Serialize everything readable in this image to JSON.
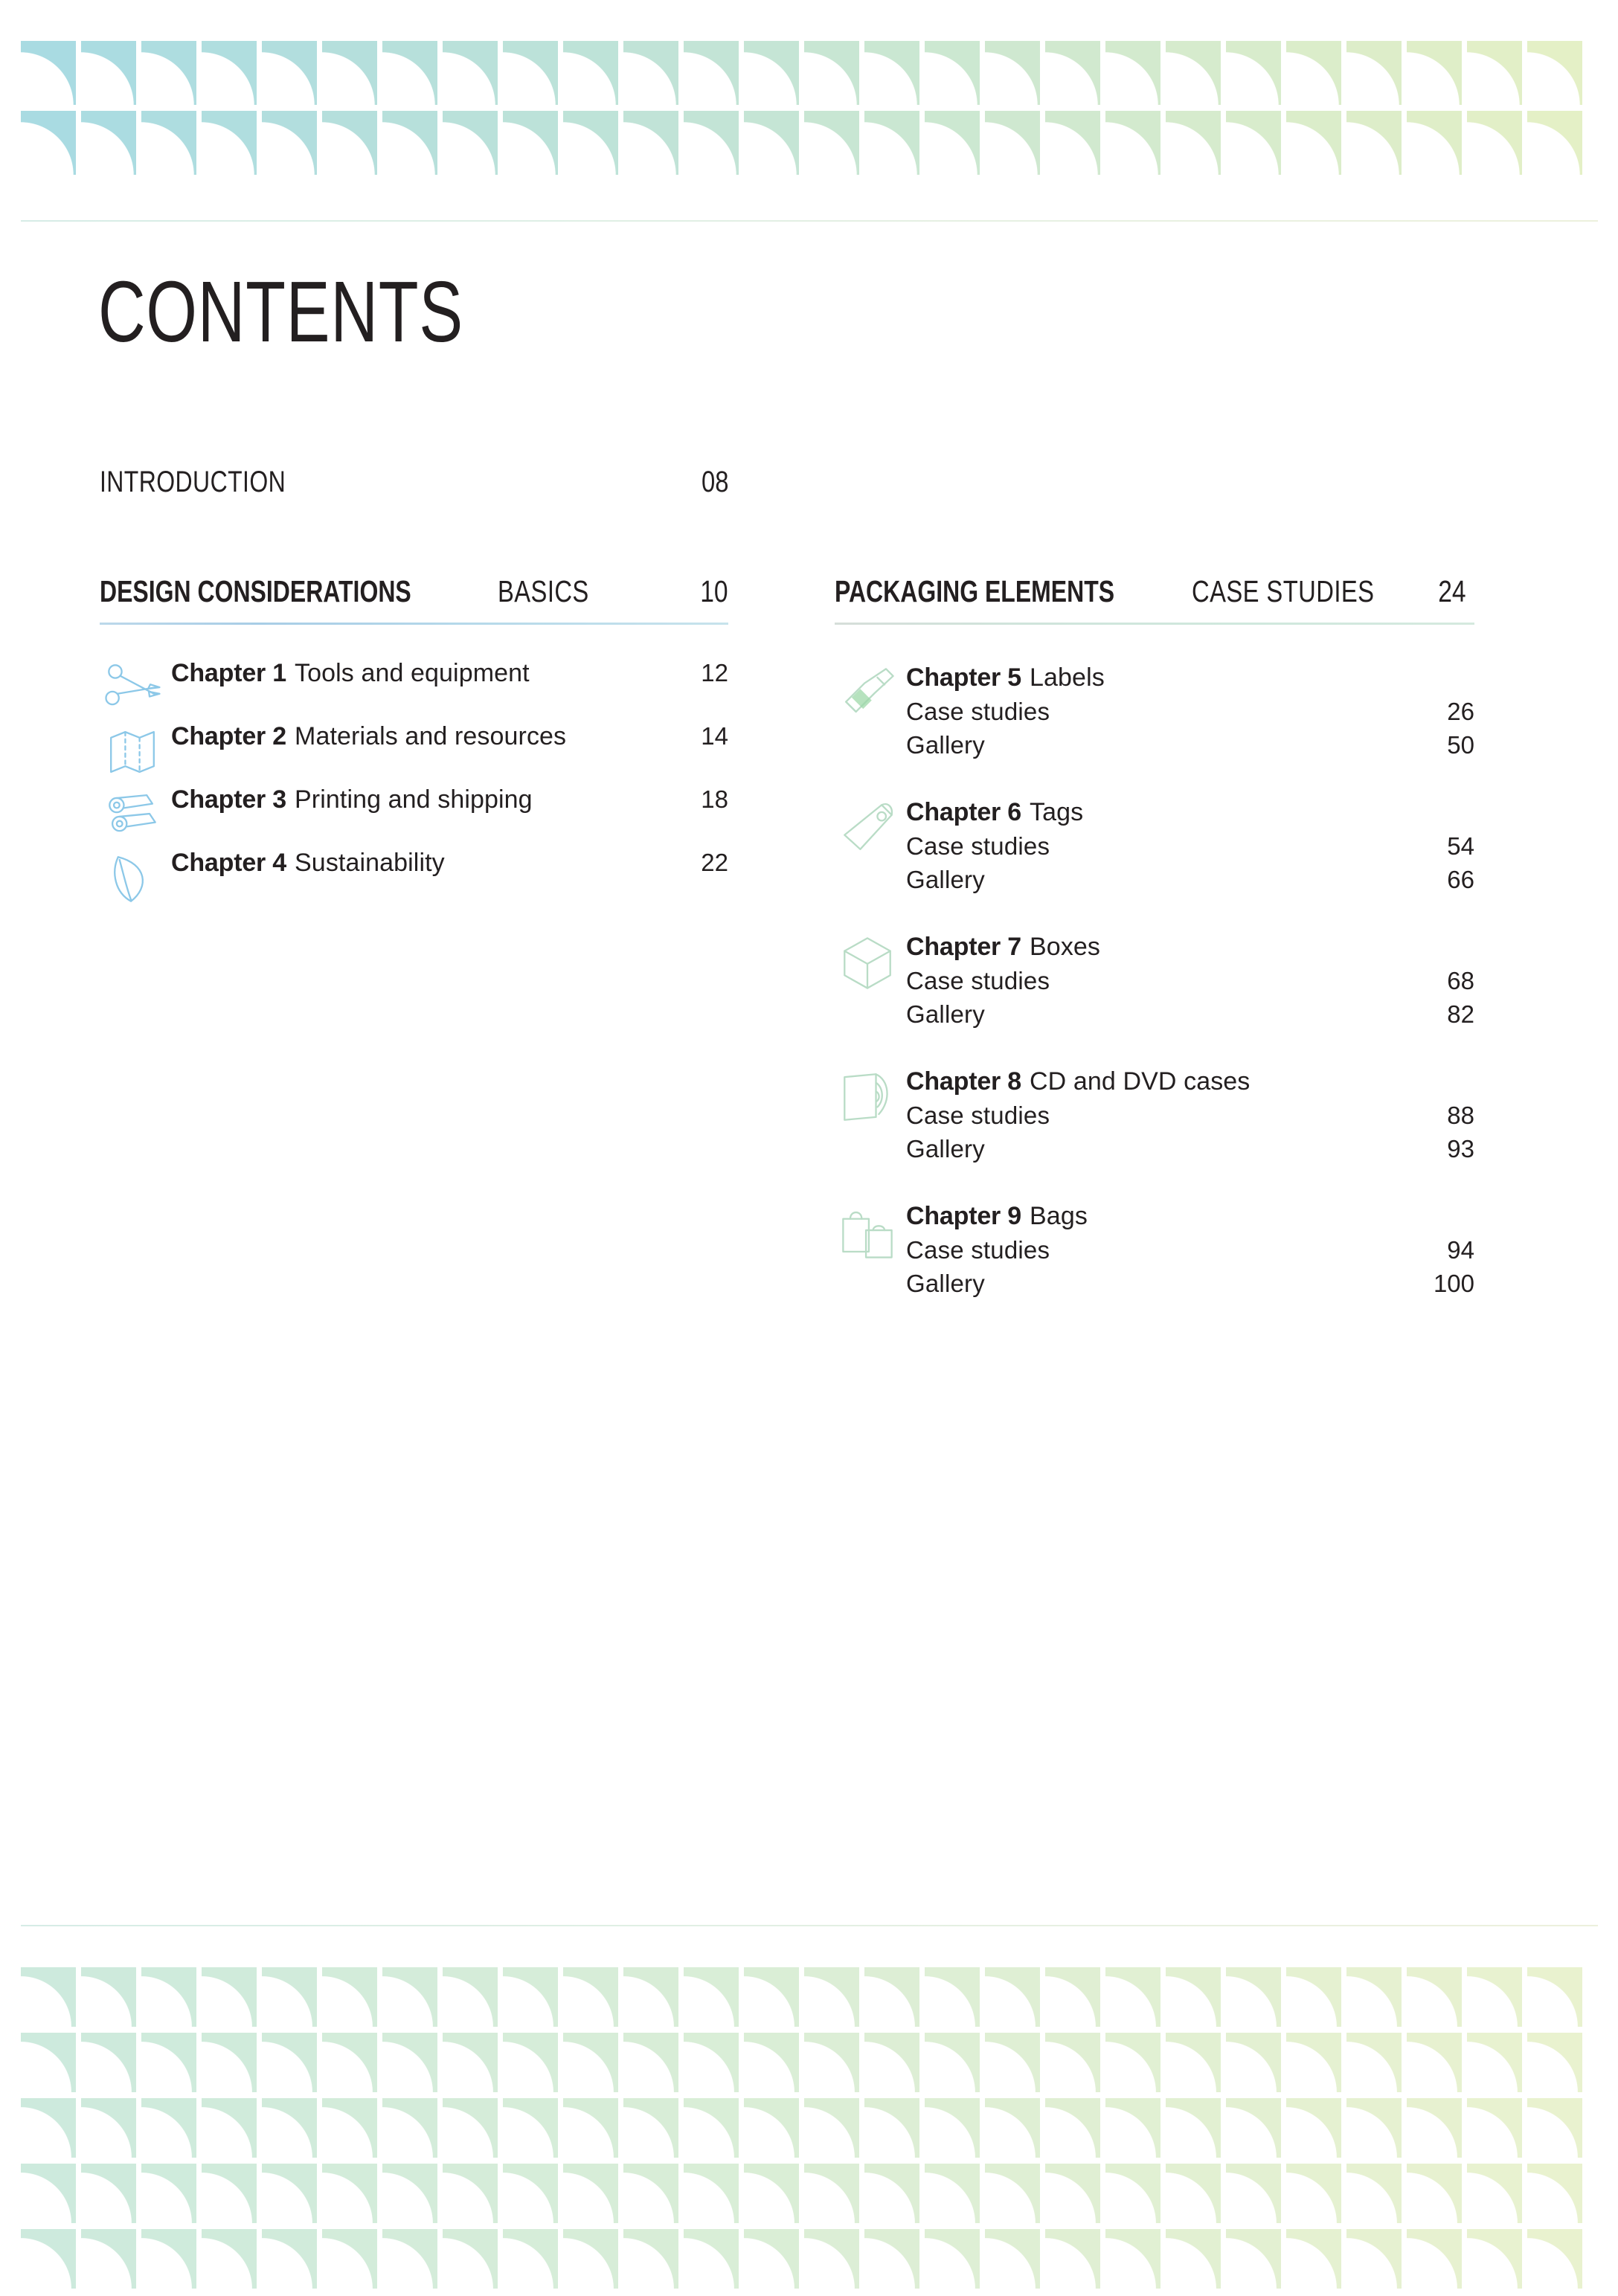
{
  "page": {
    "title": "CONTENTS",
    "accent_blue": "#8cc8e8",
    "accent_green": "#b9dcc6",
    "rule_blue": "#a8cde6",
    "rule_green": "#cfe4db",
    "text_color": "#231f20"
  },
  "intro": {
    "label": "INTRODUCTION",
    "page": "08"
  },
  "sections": [
    {
      "title_bold": "DESIGN CONSIDERATIONS",
      "title_light": "BASICS",
      "page": "10",
      "chapters": [
        {
          "number": "Chapter 1",
          "name": "Tools and equipment",
          "page": "12",
          "icon": "scissors-icon",
          "subentries": []
        },
        {
          "number": "Chapter 2",
          "name": "Materials and resources",
          "page": "14",
          "icon": "folded-map-icon",
          "subentries": []
        },
        {
          "number": "Chapter 3",
          "name": "Printing and shipping",
          "page": "18",
          "icon": "paper-rolls-icon",
          "subentries": []
        },
        {
          "number": "Chapter 4",
          "name": "Sustainability",
          "page": "22",
          "icon": "leaf-icon",
          "subentries": []
        }
      ]
    },
    {
      "title_bold": "PACKAGING ELEMENTS",
      "title_light": "CASE STUDIES",
      "page": "24",
      "chapters": [
        {
          "number": "Chapter 5",
          "name": "Labels",
          "page": "",
          "icon": "bottle-icon",
          "subentries": [
            {
              "label": "Case studies",
              "page": "26"
            },
            {
              "label": "Gallery",
              "page": "50"
            }
          ]
        },
        {
          "number": "Chapter 6",
          "name": "Tags",
          "page": "",
          "icon": "price-tag-icon",
          "subentries": [
            {
              "label": "Case studies",
              "page": "54"
            },
            {
              "label": "Gallery",
              "page": "66"
            }
          ]
        },
        {
          "number": "Chapter 7",
          "name": "Boxes",
          "page": "",
          "icon": "cube-box-icon",
          "subentries": [
            {
              "label": "Case studies",
              "page": "68"
            },
            {
              "label": "Gallery",
              "page": "82"
            }
          ]
        },
        {
          "number": "Chapter 8",
          "name": "CD and DVD cases",
          "page": "",
          "icon": "cd-case-icon",
          "subentries": [
            {
              "label": "Case studies",
              "page": "88"
            },
            {
              "label": "Gallery",
              "page": "93"
            }
          ]
        },
        {
          "number": "Chapter 9",
          "name": "Bags",
          "page": "",
          "icon": "shopping-bags-icon",
          "subentries": [
            {
              "label": "Case studies",
              "page": "94"
            },
            {
              "label": "Gallery",
              "page": "100"
            }
          ]
        }
      ]
    }
  ],
  "decoration": {
    "top_band": {
      "name": "sail-tile-pattern",
      "rows": 2,
      "columns": 26,
      "gradient_from": "#a9dbe2",
      "gradient_to": "#e4f0c6"
    },
    "bottom_band": {
      "name": "sail-tile-pattern",
      "rows": 5,
      "columns": 26,
      "gradient_from": "#cdeadd",
      "gradient_to": "#e9f2cf"
    }
  }
}
